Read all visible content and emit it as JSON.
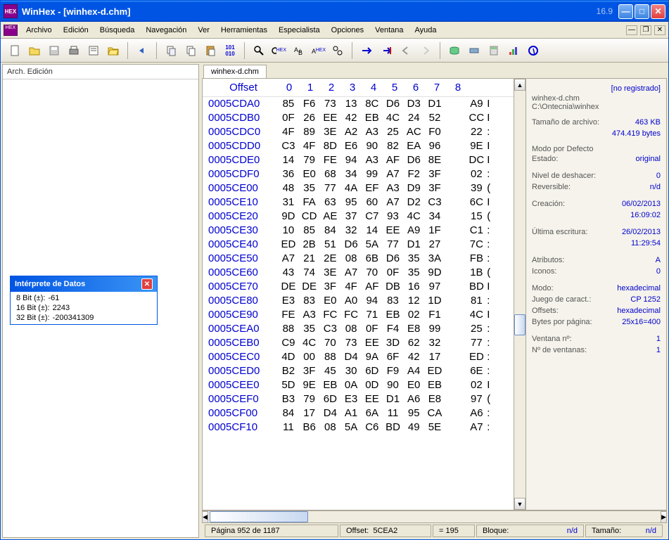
{
  "window": {
    "app": "WinHex",
    "file": "[winhex-d.chm]",
    "version": "16.9"
  },
  "menu": {
    "items": [
      "Archivo",
      "Edición",
      "Búsqueda",
      "Navegación",
      "Ver",
      "Herramientas",
      "Especialista",
      "Opciones",
      "Ventana",
      "Ayuda"
    ]
  },
  "left": {
    "header": "Arch. Edición"
  },
  "interpreter": {
    "title": "Intérprete de Datos",
    "rows": [
      {
        "label": "8 Bit (±):",
        "value": "-61"
      },
      {
        "label": "16 Bit (±):",
        "value": "2243"
      },
      {
        "label": "32 Bit (±):",
        "value": "-200341309"
      }
    ]
  },
  "tab": {
    "label": "winhex-d.chm"
  },
  "hex": {
    "header_offset": "Offset",
    "cols": [
      "0",
      "1",
      "2",
      "3",
      "4",
      "5",
      "6",
      "7",
      "8"
    ],
    "rows": [
      {
        "offset": "0005CDA0",
        "bytes": [
          "85",
          "F6",
          "73",
          "13",
          "8C",
          "D6",
          "D3",
          "D1",
          "",
          "A9"
        ],
        "tail": "I"
      },
      {
        "offset": "0005CDB0",
        "bytes": [
          "0F",
          "26",
          "EE",
          "42",
          "EB",
          "4C",
          "24",
          "52",
          "",
          "CC"
        ],
        "tail": "I"
      },
      {
        "offset": "0005CDC0",
        "bytes": [
          "4F",
          "89",
          "3E",
          "A2",
          "A3",
          "25",
          "AC",
          "F0",
          "",
          "22"
        ],
        "tail": ":"
      },
      {
        "offset": "0005CDD0",
        "bytes": [
          "C3",
          "4F",
          "8D",
          "E6",
          "90",
          "82",
          "EA",
          "96",
          "",
          "9E"
        ],
        "tail": "I"
      },
      {
        "offset": "0005CDE0",
        "bytes": [
          "14",
          "79",
          "FE",
          "94",
          "A3",
          "AF",
          "D6",
          "8E",
          "",
          "DC"
        ],
        "tail": "I"
      },
      {
        "offset": "0005CDF0",
        "bytes": [
          "36",
          "E0",
          "68",
          "34",
          "99",
          "A7",
          "F2",
          "3F",
          "",
          "02"
        ],
        "tail": ":"
      },
      {
        "offset": "0005CE00",
        "bytes": [
          "48",
          "35",
          "77",
          "4A",
          "EF",
          "A3",
          "D9",
          "3F",
          "",
          "39"
        ],
        "tail": "("
      },
      {
        "offset": "0005CE10",
        "bytes": [
          "31",
          "FA",
          "63",
          "95",
          "60",
          "A7",
          "D2",
          "C3",
          "",
          "6C"
        ],
        "tail": "I"
      },
      {
        "offset": "0005CE20",
        "bytes": [
          "9D",
          "CD",
          "AE",
          "37",
          "C7",
          "93",
          "4C",
          "34",
          "",
          "15"
        ],
        "tail": "("
      },
      {
        "offset": "0005CE30",
        "bytes": [
          "10",
          "85",
          "84",
          "32",
          "14",
          "EE",
          "A9",
          "1F",
          "",
          "C1"
        ],
        "tail": ":"
      },
      {
        "offset": "0005CE40",
        "bytes": [
          "ED",
          "2B",
          "51",
          "D6",
          "5A",
          "77",
          "D1",
          "27",
          "",
          "7C"
        ],
        "tail": ":"
      },
      {
        "offset": "0005CE50",
        "bytes": [
          "A7",
          "21",
          "2E",
          "08",
          "6B",
          "D6",
          "35",
          "3A",
          "",
          "FB"
        ],
        "tail": ":"
      },
      {
        "offset": "0005CE60",
        "bytes": [
          "43",
          "74",
          "3E",
          "A7",
          "70",
          "0F",
          "35",
          "9D",
          "",
          "1B"
        ],
        "tail": "("
      },
      {
        "offset": "0005CE70",
        "bytes": [
          "DE",
          "DE",
          "3F",
          "4F",
          "AF",
          "DB",
          "16",
          "97",
          "",
          "BD"
        ],
        "tail": "I"
      },
      {
        "offset": "0005CE80",
        "bytes": [
          "E3",
          "83",
          "E0",
          "A0",
          "94",
          "83",
          "12",
          "1D",
          "",
          "81"
        ],
        "tail": ":"
      },
      {
        "offset": "0005CE90",
        "bytes": [
          "FE",
          "A3",
          "FC",
          "FC",
          "71",
          "EB",
          "02",
          "F1",
          "",
          "4C"
        ],
        "tail": "I"
      },
      {
        "offset": "0005CEA0",
        "bytes": [
          "88",
          "35",
          "C3",
          "08",
          "0F",
          "F4",
          "E8",
          "99",
          "",
          "25"
        ],
        "tail": ":"
      },
      {
        "offset": "0005CEB0",
        "bytes": [
          "C9",
          "4C",
          "70",
          "73",
          "EE",
          "3D",
          "62",
          "32",
          "",
          "77"
        ],
        "tail": ":"
      },
      {
        "offset": "0005CEC0",
        "bytes": [
          "4D",
          "00",
          "88",
          "D4",
          "9A",
          "6F",
          "42",
          "17",
          "",
          "ED"
        ],
        "tail": ":"
      },
      {
        "offset": "0005CED0",
        "bytes": [
          "B2",
          "3F",
          "45",
          "30",
          "6D",
          "F9",
          "A4",
          "ED",
          "",
          "6E"
        ],
        "tail": ":"
      },
      {
        "offset": "0005CEE0",
        "bytes": [
          "5D",
          "9E",
          "EB",
          "0A",
          "0D",
          "90",
          "E0",
          "EB",
          "",
          "02"
        ],
        "tail": "I"
      },
      {
        "offset": "0005CEF0",
        "bytes": [
          "B3",
          "79",
          "6D",
          "E3",
          "EE",
          "D1",
          "A6",
          "E8",
          "",
          "97"
        ],
        "tail": "("
      },
      {
        "offset": "0005CF00",
        "bytes": [
          "84",
          "17",
          "D4",
          "A1",
          "6A",
          "11",
          "95",
          "CA",
          "",
          "A6"
        ],
        "tail": ":"
      },
      {
        "offset": "0005CF10",
        "bytes": [
          "11",
          "B6",
          "08",
          "5A",
          "C6",
          "BD",
          "49",
          "5E",
          "",
          "A7"
        ],
        "tail": ":"
      }
    ]
  },
  "info": {
    "unregistered": "[no registrado]",
    "filename": "winhex-d.chm",
    "path": "C:\\Ontecnia\\winhex",
    "size_label": "Tamaño de archivo:",
    "size_kb": "463 KB",
    "size_bytes": "474.419 bytes",
    "mode_default": "Modo por Defecto",
    "state_label": "Estado:",
    "state_value": "original",
    "undo_label": "Nivel de deshacer:",
    "undo_value": "0",
    "rev_label": "Reversible:",
    "rev_value": "n/d",
    "created_label": "Creación:",
    "created_date": "06/02/2013",
    "created_time": "16:09:02",
    "modified_label": "Última escritura:",
    "modified_date": "26/02/2013",
    "modified_time": "11:29:54",
    "attr_label": "Atributos:",
    "attr_value": "A",
    "icons_label": "Iconos:",
    "icons_value": "0",
    "mode_label": "Modo:",
    "mode_value": "hexadecimal",
    "charset_label": "Juego de caract.:",
    "charset_value": "CP 1252",
    "offsets_label": "Offsets:",
    "offsets_value": "hexadecimal",
    "bpp_label": "Bytes por página:",
    "bpp_value": "25x16=400",
    "winno_label": "Ventana nº:",
    "winno_value": "1",
    "wincount_label": "Nº de ventanas:",
    "wincount_value": "1"
  },
  "status": {
    "page": "Página 952 de 1187",
    "offset_label": "Offset:",
    "offset_value": "5CEA2",
    "eq_label": "= 195",
    "block_label": "Bloque:",
    "block_value": "n/d",
    "size_label": "Tamaño:",
    "size_value": "n/d"
  }
}
